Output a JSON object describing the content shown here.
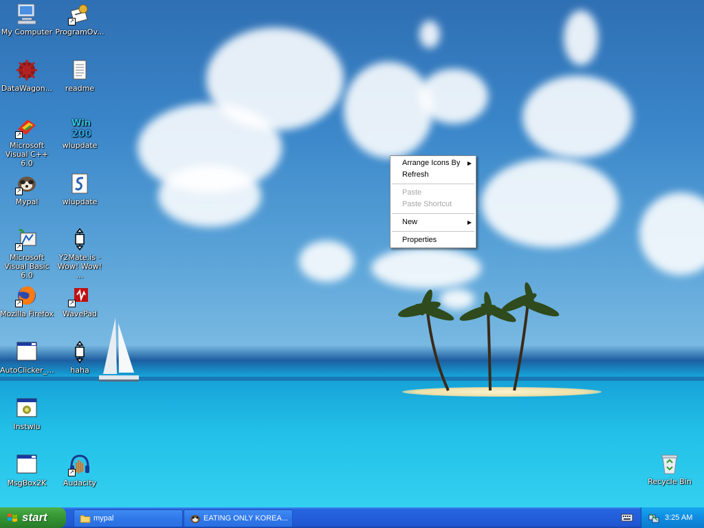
{
  "desktop": {
    "icons": [
      {
        "label": "My Computer",
        "icon": "computer-icon"
      },
      {
        "label": "ProgramOv...",
        "icon": "program-icon"
      },
      {
        "label": "DataWagon...",
        "icon": "datawagon-icon"
      },
      {
        "label": "readme",
        "icon": "text-file-icon"
      },
      {
        "label": "Microsoft Visual C++ 6.0",
        "icon": "visual-cpp-icon"
      },
      {
        "label": "wlupdate",
        "icon": "win2000-icon"
      },
      {
        "label": "Mypal",
        "icon": "mypal-icon"
      },
      {
        "label": "wlupdate",
        "icon": "script-file-icon"
      },
      {
        "label": "Microsoft Visual Basic 6.0",
        "icon": "visual-basic-icon"
      },
      {
        "label": "Y2Mate.is - Wow! Wow! ...",
        "icon": "move-arrows-icon"
      },
      {
        "label": "Mozilla Firefox",
        "icon": "firefox-icon"
      },
      {
        "label": "WavePad",
        "icon": "wavepad-icon"
      },
      {
        "label": "AutoClicker_...",
        "icon": "window-icon"
      },
      {
        "label": "haha",
        "icon": "move-arrows-icon"
      },
      {
        "label": "Instwlu",
        "icon": "installer-icon"
      },
      {
        "label": "MsgBox2K",
        "icon": "window-icon"
      },
      {
        "label": "Audacity",
        "icon": "audacity-icon"
      },
      {
        "label": "Recycle Bin",
        "icon": "recycle-bin-icon"
      }
    ]
  },
  "context_menu": {
    "arrange": "Arrange Icons By",
    "refresh": "Refresh",
    "paste": "Paste",
    "paste_shortcut": "Paste Shortcut",
    "new": "New",
    "properties": "Properties",
    "submenu_arrow": "▶"
  },
  "taskbar": {
    "start_label": "start",
    "tasks": [
      {
        "label": "mypal",
        "icon": "folder-icon"
      },
      {
        "label": "EATING ONLY KOREA...",
        "icon": "mypal-icon"
      }
    ],
    "clock": "3:25 AM"
  },
  "colors": {
    "taskbar": "#245edb",
    "start_button": "#3c9d3a",
    "tray": "#0f8ce0"
  }
}
